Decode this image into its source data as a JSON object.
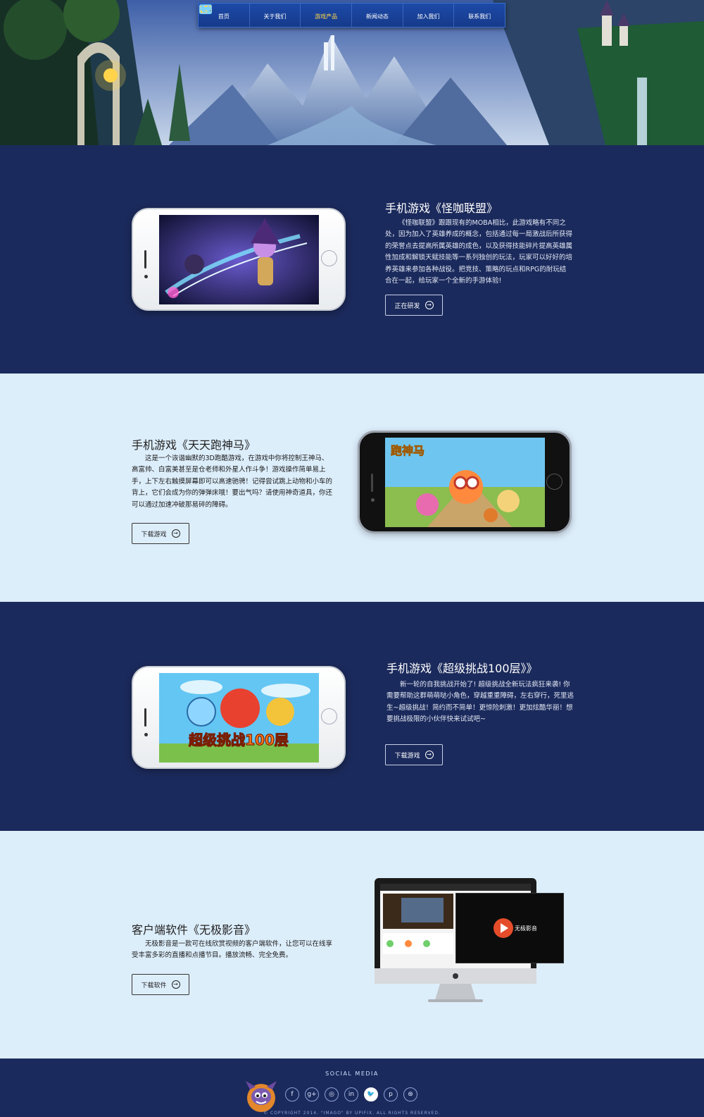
{
  "nav": {
    "items": [
      {
        "label": "首页",
        "icon": "home-icon"
      },
      {
        "label": "关于我们",
        "icon": "people-icon"
      },
      {
        "label": "游戏产品",
        "icon": "gamepad-icon",
        "active": true
      },
      {
        "label": "新闻动态",
        "icon": "news-icon"
      },
      {
        "label": "加入我们",
        "icon": "handshake-icon"
      },
      {
        "label": "联系我们",
        "icon": "phone-icon"
      }
    ],
    "active_color": "#ffd84a"
  },
  "products": [
    {
      "title": "手机游戏《怪咖联盟》",
      "description": "《怪咖联盟》跟跟现有的MOBA相比，此游戏略有不同之处，因为加入了英雄养成的概念，包括通过每一局激战后所获得的荣誉点去提高所属英雄的成色，以及获得技能碎片提高英雄属性加成和解锁天赋技能等一系列独创的玩法，玩家可以好好的培养英雄来参加各种战役。把竞技、策略的玩点和RPG的耐玩结合在一起，给玩家一个全新的手游体验!",
      "button": "正在研发"
    },
    {
      "title": "手机游戏《天天跑神马》",
      "description": "这是一个诙谐幽默的3D跑酷游戏，在游戏中你将控制王神马、高富帅、白富美甚至是仓老师和外星人作斗争！游戏操作简单易上手，上下左右触摸屏幕即可以高速驰骋！记得尝试跳上动物和小车的背上，它们会成为你的弹弹床哦！要出气吗？请使用神奇道具，你还可以通过加速冲破那易碎的障碍。",
      "button": "下载游戏",
      "screen_logo": "跑神马"
    },
    {
      "title": "手机游戏《超级挑战100层》》",
      "description": "新一轮的自我挑战开始了! 超级挑战全新玩法疯狂来袭! 你需要帮助这群萌萌哒小角色，穿越重重障碍，左右穿行，死里逃生~超级挑战！简约而不简单！更惊险刺激！更加炫酷华丽！想要挑战极限的小伙伴快来试试吧~",
      "button": "下载游戏",
      "screen_logo": "超级挑战100层"
    },
    {
      "title": "客户端软件《无极影音》",
      "description": "无极影音是一款可在线欣赏视频的客户端软件，让您可以在线享受丰富多彩的直播和点播节目。播放流畅、完全免费。",
      "button": "下载软件",
      "screen_logo": "无极影音"
    }
  ],
  "footer": {
    "social_title": "SOCIAL MEDIA",
    "social_icons": [
      "facebook-icon",
      "google-plus-icon",
      "instagram-icon",
      "linkedin-icon",
      "twitter-icon",
      "pinterest-icon",
      "dribbble-icon"
    ],
    "social_glyphs": [
      "f",
      "g+",
      "◎",
      "in",
      "🐦",
      "p",
      "⊛"
    ],
    "copyright": "© COPYRIGHT 2014. \"IMAGO\" BY UPIFIX. ALL RIGHTS RESERVED."
  },
  "colors": {
    "dark_bg": "#1b2a5c",
    "light_bg": "#ddeefb"
  }
}
